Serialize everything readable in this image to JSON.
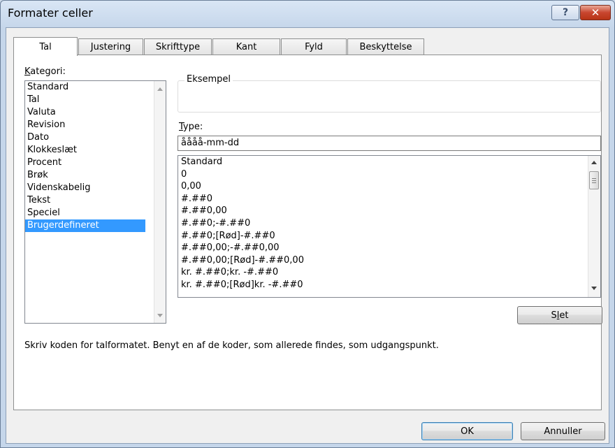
{
  "window": {
    "title": "Formater celler"
  },
  "titlebar": {
    "help_glyph": "?",
    "close_glyph": "✕"
  },
  "tabs": [
    {
      "label": "Tal"
    },
    {
      "label": "Justering"
    },
    {
      "label": "Skrifttype"
    },
    {
      "label": "Kant"
    },
    {
      "label": "Fyld"
    },
    {
      "label": "Beskyttelse"
    }
  ],
  "category": {
    "label_first": "K",
    "label_rest": "ategori:",
    "items": [
      "Standard",
      "Tal",
      "Valuta",
      "Revision",
      "Dato",
      "Klokkeslæt",
      "Procent",
      "Brøk",
      "Videnskabelig",
      "Tekst",
      "Speciel",
      "Brugerdefineret"
    ],
    "selected": "Brugerdefineret"
  },
  "sample": {
    "legend": "Eksempel",
    "value": ""
  },
  "type": {
    "label_first": "T",
    "label_rest": "ype:",
    "value": "åååå-mm-dd",
    "formats": [
      "Standard",
      "0",
      "0,00",
      "#.##0",
      "#.##0,00",
      "#.##0;-#.##0",
      "#.##0;[Rød]-#.##0",
      "#.##0,00;-#.##0,00",
      "#.##0,00;[Rød]-#.##0,00",
      "kr. #.##0;kr. -#.##0",
      "kr. #.##0;[Rød]kr. -#.##0"
    ]
  },
  "delete_button": {
    "pre": "S",
    "accel": "l",
    "post": "et"
  },
  "hint": "Skriv koden for talformatet. Benyt en af de koder, som allerede findes, som udgangspunkt.",
  "buttons": {
    "ok": "OK",
    "cancel": "Annuller"
  }
}
